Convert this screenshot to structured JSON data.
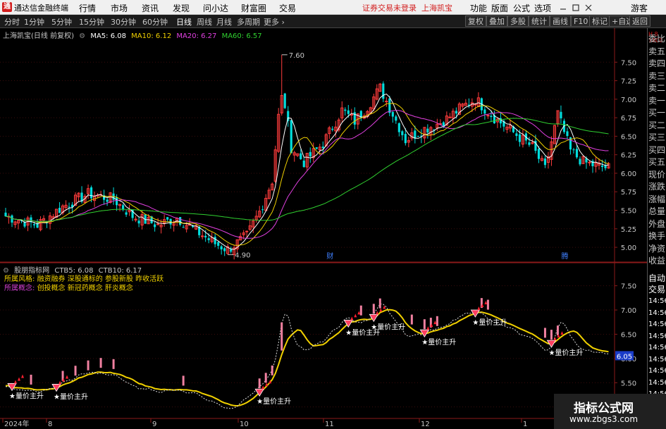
{
  "menubar": {
    "logo_glyph": "通",
    "app_title": "通达信金融终端",
    "items": [
      "行情",
      "市场",
      "资讯",
      "发现",
      "问小达",
      "财富圈",
      "交易"
    ],
    "login_notice": "证券交易未登录",
    "stock": "上海凯宝",
    "right_items": [
      "功能",
      "版面",
      "公式",
      "选项"
    ],
    "user": "游客"
  },
  "toolbar": {
    "periods": [
      "分时",
      "1分钟",
      "5分钟",
      "15分钟",
      "30分钟",
      "60分钟",
      "日线",
      "周线",
      "月线",
      "多周期",
      "更多"
    ],
    "active_period": "日线",
    "buttons": [
      "复权",
      "叠加",
      "多股",
      "统计",
      "画线",
      "F10",
      "标记",
      "+自选",
      "返回"
    ]
  },
  "main_chart": {
    "stock_label": "上海凯宝(日线 前复权)",
    "ma": [
      {
        "label": "MA5: 6.08",
        "color": "#ffffff"
      },
      {
        "label": "MA10: 6.12",
        "color": "#f0d000"
      },
      {
        "label": "MA20: 6.27",
        "color": "#e040e0"
      },
      {
        "label": "MA60: 6.57",
        "color": "#30d030"
      }
    ],
    "price_ticks": [
      "7.50",
      "7.25",
      "7.00",
      "6.75",
      "6.50",
      "6.25",
      "6.00",
      "5.75",
      "5.50",
      "5.25",
      "5.00"
    ],
    "high_label": "7.60",
    "low_label": "4.90",
    "markers": [
      "财",
      "腾"
    ]
  },
  "indicator": {
    "name": "股朋指标网",
    "ctb5": "CTB5: 6.08",
    "ctb10": "CTB10: 6.17",
    "style_label": "所属风格:",
    "style_text": "融资融券 深股通标的 参股新股 昨收活跃",
    "concept_label": "所属概念:",
    "concept_text": "创投概念 新冠药概念 肝炎概念",
    "signal_text": "★量价主升",
    "price_ticks": [
      "7.50",
      "7.00",
      "6.50",
      "6.00",
      "5.50",
      "5.00"
    ],
    "current_value": "6.05"
  },
  "time_axis": {
    "labels": [
      "2024年",
      "8",
      "9",
      "10",
      "11",
      "12",
      "1"
    ]
  },
  "right_panel": {
    "icon_text": "H 8 1000",
    "items": [
      "委比",
      "卖五",
      "卖四",
      "卖三",
      "卖二",
      "卖一",
      "买一",
      "买二",
      "买三",
      "买四",
      "买五",
      "现价",
      "涨跌",
      "涨幅",
      "总量",
      "外盘",
      "换手",
      "净资",
      "收益",
      "",
      "自动",
      "交易",
      "14:56",
      "14:56",
      "14:56",
      "14:56",
      "14:56",
      "14:56",
      "14:56",
      "14:56",
      "14:56",
      "14:56"
    ]
  },
  "watermark": {
    "title": "指标公式网",
    "url": "www.zbgs3.com"
  },
  "colors": {
    "up": "#ff3c3c",
    "down": "#00dddd",
    "ma60": "#30d030",
    "ctb": "#f0d000"
  }
}
